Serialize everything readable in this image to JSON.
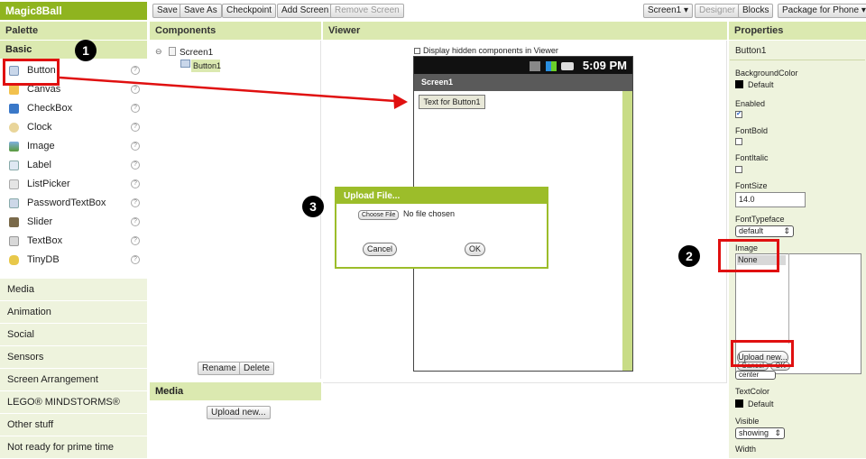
{
  "topbar": {
    "project": "Magic8Ball",
    "buttons": [
      "Save",
      "Save As",
      "Checkpoint",
      "Add Screen",
      "Remove Screen"
    ],
    "screen_select": "Screen1 ▾",
    "designer": "Designer",
    "blocks": "Blocks",
    "package": "Package for Phone ▾"
  },
  "headers": {
    "palette": "Palette",
    "components": "Components",
    "viewer": "Viewer",
    "properties": "Properties"
  },
  "palette": {
    "basic": "Basic",
    "items": [
      "Button",
      "Canvas",
      "CheckBox",
      "Clock",
      "Image",
      "Label",
      "ListPicker",
      "PasswordTextBox",
      "Slider",
      "TextBox",
      "TinyDB"
    ],
    "categories": [
      "Media",
      "Animation",
      "Social",
      "Sensors",
      "Screen Arrangement",
      "LEGO® MINDSTORMS®",
      "Other stuff",
      "Not ready for prime time"
    ]
  },
  "components": {
    "screen": "Screen1",
    "button": "Button1",
    "rename": "Rename",
    "delete": "Delete",
    "media_title": "Media",
    "upload_new": "Upload new..."
  },
  "viewer": {
    "hidden_checkbox": "Display hidden components in Viewer",
    "time": "5:09 PM",
    "screen_title": "Screen1",
    "button_text": "Text for Button1"
  },
  "dialog": {
    "title": "Upload File...",
    "choose": "Choose File",
    "no_file": "No file chosen",
    "cancel": "Cancel",
    "ok": "OK"
  },
  "properties": {
    "component": "Button1",
    "background_color_label": "BackgroundColor",
    "background_color_value": "Default",
    "enabled_label": "Enabled",
    "fontbold_label": "FontBold",
    "fontitalic_label": "FontItalic",
    "fontsize_label": "FontSize",
    "fontsize_value": "14.0",
    "fonttypeface_label": "FontTypeface",
    "fonttypeface_value": "default",
    "image_label": "Image",
    "image_value": "None",
    "image_upload": "Upload new...",
    "image_cancel": "Cancel",
    "image_ok": "OK",
    "image_center": "center",
    "textcolor_label": "TextColor",
    "textcolor_value": "Default",
    "visible_label": "Visible",
    "visible_value": "showing",
    "width_label": "Width"
  },
  "annotations": [
    "1",
    "2",
    "3"
  ],
  "colors": {
    "accent": "#8fb41f",
    "header": "#dbe9b0",
    "annotation_red": "#e01010"
  }
}
